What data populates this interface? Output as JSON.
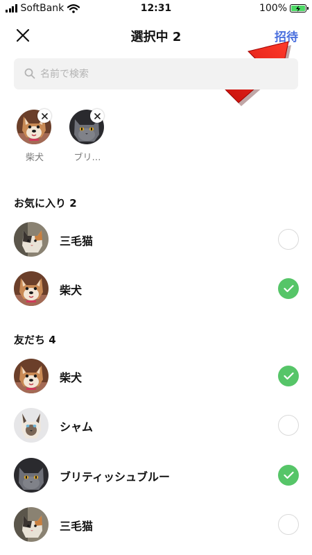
{
  "status_bar": {
    "carrier": "SoftBank",
    "time": "12:31",
    "battery": "100%"
  },
  "header": {
    "title": "選択中 2",
    "invite_label": "招待"
  },
  "search": {
    "placeholder": "名前で検索"
  },
  "selected": [
    {
      "label": "柴犬",
      "avatar": "shiba"
    },
    {
      "label": "ブリ…",
      "avatar": "british"
    }
  ],
  "favorites": {
    "title": "お気に入り 2",
    "items": [
      {
        "name": "三毛猫",
        "avatar": "mike",
        "checked": false
      },
      {
        "name": "柴犬",
        "avatar": "shiba",
        "checked": true
      }
    ]
  },
  "friends": {
    "title": "友だち 4",
    "items": [
      {
        "name": "柴犬",
        "avatar": "shiba",
        "checked": true
      },
      {
        "name": "シャム",
        "avatar": "siamese",
        "checked": false
      },
      {
        "name": "ブリティッシュブルー",
        "avatar": "british",
        "checked": true
      },
      {
        "name": "三毛猫",
        "avatar": "mike",
        "checked": false
      }
    ]
  },
  "colors": {
    "accent": "#4a6fde",
    "check_on": "#56c568",
    "search_bg": "#f2f2f2",
    "annotation_arrow": "#e8201a"
  }
}
